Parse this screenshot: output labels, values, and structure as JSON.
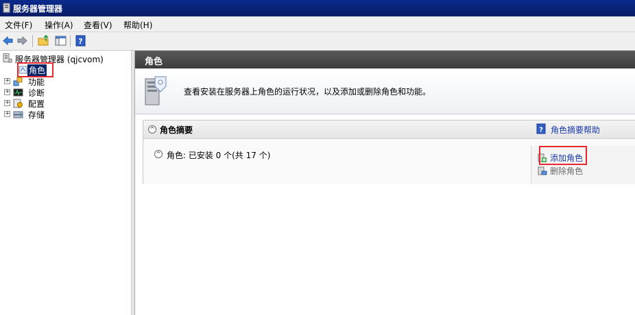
{
  "window": {
    "title": "服务器管理器"
  },
  "menu": [
    "文件(F)",
    "操作(A)",
    "查看(V)",
    "帮助(H)"
  ],
  "toolbar": {
    "icons": [
      "back-icon",
      "forward-icon",
      "up-folder-icon",
      "show-hide-tree-icon",
      "help-icon"
    ]
  },
  "tree": {
    "root": "服务器管理器 (qjcvom)",
    "items": [
      {
        "label": "角色",
        "selected": true,
        "expandable": false
      },
      {
        "label": "功能",
        "selected": false,
        "expandable": true
      },
      {
        "label": "诊断",
        "selected": false,
        "expandable": true
      },
      {
        "label": "配置",
        "selected": false,
        "expandable": true
      },
      {
        "label": "存储",
        "selected": false,
        "expandable": true
      }
    ]
  },
  "pane": {
    "header": "角色",
    "intro": "查看安装在服务器上角色的运行状况，以及添加或删除角色和功能。",
    "summary": {
      "title": "角色摘要",
      "help": "角色摘要帮助",
      "roles_status": "角色: 已安装 0 个(共 17 个)",
      "actions": {
        "add": "添加角色",
        "remove": "删除角色"
      }
    }
  },
  "colors": {
    "highlight_box": "#e8262d",
    "link": "#1a3aa8",
    "selection": "#0a246a"
  }
}
